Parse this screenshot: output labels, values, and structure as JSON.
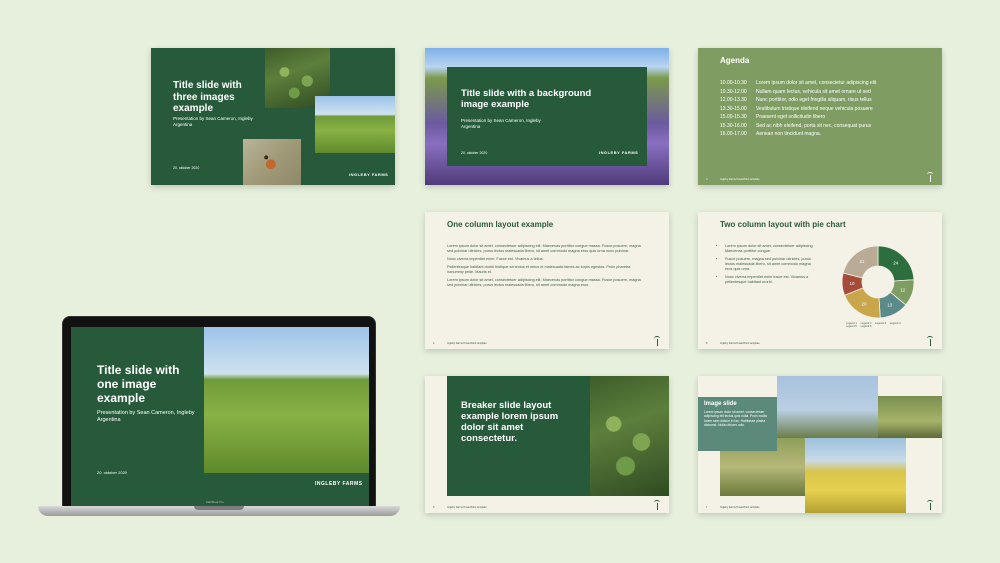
{
  "colors": {
    "background": "#e6f0dc",
    "brand_green": "#265a3b",
    "olive": "#7f9d62",
    "cream": "#f4f1e6",
    "pie": [
      "#2c6e3e",
      "#7f9d62",
      "#5b8a8a",
      "#c9a64a",
      "#a64a3a",
      "#b9ab96"
    ]
  },
  "brand": {
    "logo": "INGLEBY FARMS"
  },
  "slide_three_images": {
    "title": "Title slide with three images example",
    "subtitle": "Presentation by Sean Cameron, Ingleby Argentina",
    "date": "20. oktober 2020"
  },
  "slide_background": {
    "title": "Title slide with a background image example",
    "subtitle": "Presentation by Sean Cameron, Ingleby Argentina",
    "date": "20. oktober 2020"
  },
  "slide_agenda": {
    "title": "Agenda",
    "items": [
      {
        "time": "10.00-10.30",
        "text": "Lorem ipsum dolor sit amet, consectetur adipiscing elit"
      },
      {
        "time": "10.30-12.00",
        "text": "Nullam quam lectus, vehicula sit amet ornare ut sed"
      },
      {
        "time": "12.00-13.30",
        "text": "Nunc porttitor, odio eget fringilla aliquam, risus tellus"
      },
      {
        "time": "13.30-15.00",
        "text": "Vestibulum tristique eleifend neque vehicula posuere"
      },
      {
        "time": "15.00-15.30",
        "text": "Praesent eget sollicitudin libero"
      },
      {
        "time": "15.30-16.00",
        "text": "Sed ac nibh eleifend, porta sit nec, consequat purus"
      },
      {
        "time": "16.00-17.00",
        "text": "Aenean non tincidunt magna."
      }
    ],
    "footer": "Ingleby Farms PowerPoint template",
    "page": "3"
  },
  "slide_one_column": {
    "title": "One column layout example",
    "paragraphs": [
      "Lorem ipsum dolor sit amet, consectetuer adipiscing elit. Maecenas porttitor congue massa. Fusce posuere, magna sed pulvinar ultricies, purus lectus malesuada libero, sit amet commodo magna eros quis urna nunc pulvinar.",
      "Nunc viverra imperdiet enim. Fusce est. Vivamus a tellus.",
      "Pellentesque habitant morbi tristique senectus et netus et malesuada fames ac turpis egestas. Proin pharetra nonummy pede. Mauris et.",
      "Lorem ipsum dolor sit amet, consectetuer adipiscing elit. Maecenas porttitor congue massa. Fusce posuere, magna sed pulvinar ultricies, purus lectus malesuada libero, sit amet commodo magna eros."
    ],
    "footer": "Ingleby Farms PowerPoint template",
    "page": "4"
  },
  "slide_pie": {
    "title": "Two column layout with pie chart",
    "bullets": [
      "Lorem ipsum dolor sit amet, consectetuer adipiscing. Maecenas porttitor congue.",
      "Fusce posuere, magna sed pulvinar ultricies, purus lectus malesuada libero, sit amet commodo magna eros quis urna.",
      "Nunc viverra imperdiet enim fusce est. Vivamus a pellentesque habitant morbi."
    ],
    "legend": [
      "Legend 1",
      "Legend 2",
      "Legend 3",
      "Legend 4",
      "Legend 5",
      "Legend 6"
    ],
    "footer": "Ingleby Farms PowerPoint template",
    "page": "5"
  },
  "chart_data": {
    "type": "pie",
    "categories": [
      "Legend 1",
      "Legend 2",
      "Legend 3",
      "Legend 4",
      "Legend 5",
      "Legend 6"
    ],
    "values": [
      24,
      12,
      13,
      20,
      10,
      21
    ],
    "title": ""
  },
  "slide_breaker": {
    "title": "Breaker slide layout example lorem ipsum dolor sit amet consectetur.",
    "footer": "Ingleby Farms PowerPoint template",
    "page": "6"
  },
  "slide_image": {
    "title": "Image slide",
    "body": "Lorem ipsum dolor sit amet, consectetuer adipiscing elit lectus quis nulla. Proin mollis lorem sem dictum in fac. Habitasse platea dictumst. Nulla ultrices odio.",
    "footer": "Ingleby Farms PowerPoint template",
    "page": "7"
  },
  "laptop": {
    "title": "Title slide with one image example",
    "subtitle": "Presentation by Sean Cameron, Ingleby Argentina",
    "date": "20. oktober 2020",
    "device_label": "MacBook Pro"
  }
}
